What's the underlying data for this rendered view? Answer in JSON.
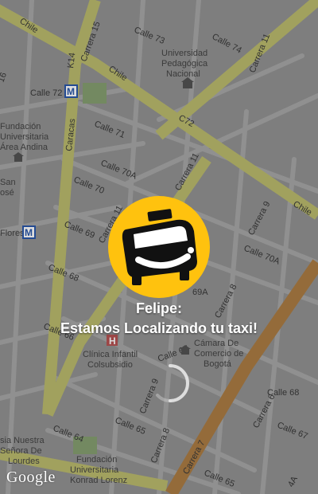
{
  "map": {
    "streets": {
      "chile_top": "Chile",
      "chile_mid": "Chile",
      "chile_right": "Chile",
      "carrera_15": "Carrera 15",
      "k14": "K14",
      "caracas": "Caracas",
      "calle_73": "Calle 73",
      "calle_74": "Calle 74",
      "carrera_11": "Carrera 11",
      "calle_72": "Calle 72",
      "c72": "C72",
      "calle_71": "Calle 71",
      "calle_70a": "Calle 70A",
      "calle_70": "Calle 70",
      "carrera_11_mid": "Carrera 11",
      "carrera_9_top": "Carrera 9",
      "calle_69": "Calle 69",
      "carrera_11_low": "Carrera 11",
      "calle_70a_right": "Calle 70A",
      "calle_68": "Calle 68",
      "calle_69a": "69A",
      "carrera_8": "Carrera 8",
      "calle_66": "Calle 66",
      "calle_67": "Calle 67",
      "carrera_9_bottom": "Carrera 9",
      "calle_68_right": "Calle 68",
      "carrera_6": "Carrera 6",
      "calle_64": "Calle 64",
      "calle_65": "Calle 65",
      "carrera_8_bottom": "Carrera 8",
      "carrera_7": "Carrera 7",
      "calle_67_right": "Calle 67",
      "calle_65_bottom": "Calle 65",
      "num_16": "16",
      "carrera_4a": "4A"
    },
    "pois": {
      "universidad_line1": "Universidad",
      "universidad_line2": "Pedagógica",
      "universidad_line3": "Nacional",
      "fundacion_area_line1": "Fundación",
      "fundacion_area_line2": "Universitaria",
      "fundacion_area_line3": "Área Andina",
      "san_jose_line1": "San",
      "san_jose_line2": "osé",
      "flores": "Flores",
      "clinica_line1": "Clínica Infantil",
      "clinica_line2": "Colsubsidio",
      "camara_line1": "Cámara De",
      "camara_line2": "Comercio de",
      "camara_line3": "Bogotá",
      "iglesia_line1": "sia Nuestra",
      "iglesia_line2": "Señora De",
      "iglesia_line3": "Lourdes",
      "fundacion_konrad_line1": "Fundación",
      "fundacion_konrad_line2": "Universitaria",
      "fundacion_konrad_line3": "Konrad Lorenz",
      "hospital_marker": "H",
      "metro_marker": "M"
    },
    "attribution": "Google"
  },
  "overlay": {
    "user_name": "Felipe:",
    "status_message": "Estamos Localizando tu taxi!"
  },
  "colors": {
    "accent_yellow": "#FFC20E",
    "map_bg": "#8e8e8e",
    "road_major": "#b8b866",
    "road_arterial": "#a8763a"
  },
  "icons": {
    "logo": "taxi-icon",
    "loading": "spinner-icon",
    "metro": "metro-station-icon",
    "hospital": "hospital-icon",
    "university": "university-icon",
    "bank": "bank-icon"
  }
}
